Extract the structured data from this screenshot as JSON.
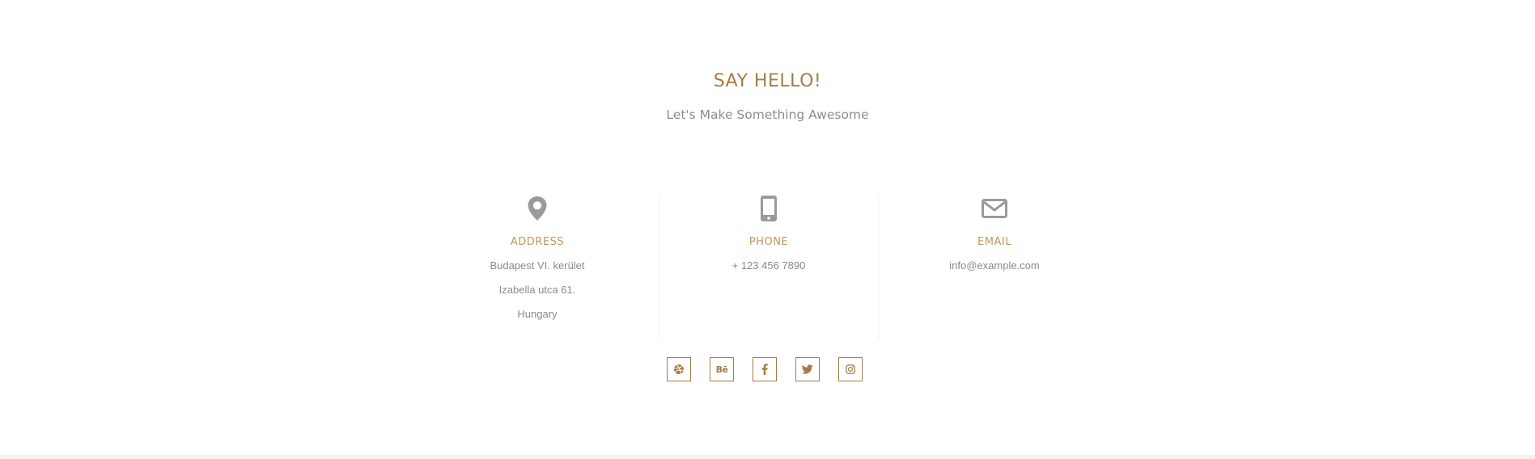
{
  "section": {
    "title": "SAY HELLO!",
    "subtitle": "Let's Make Something Awesome"
  },
  "contacts": [
    {
      "icon": "map-marker-icon",
      "label": "ADDRESS",
      "lines": [
        "Budapest VI. kerület",
        "Izabella utca 61.",
        "Hungary"
      ]
    },
    {
      "icon": "mobile-phone-icon",
      "label": "PHONE",
      "lines": [
        "+ 123 456 7890"
      ]
    },
    {
      "icon": "envelope-icon",
      "label": "EMAIL",
      "lines": [
        "info@example.com"
      ]
    }
  ],
  "social": [
    {
      "icon": "dribbble-icon"
    },
    {
      "icon": "behance-icon",
      "text": "Bē"
    },
    {
      "icon": "facebook-icon"
    },
    {
      "icon": "twitter-icon"
    },
    {
      "icon": "instagram-icon"
    }
  ],
  "colors": {
    "accent": "#a67c46",
    "label": "#c29560",
    "icon": "#999999",
    "text": "#8a8a8a"
  }
}
